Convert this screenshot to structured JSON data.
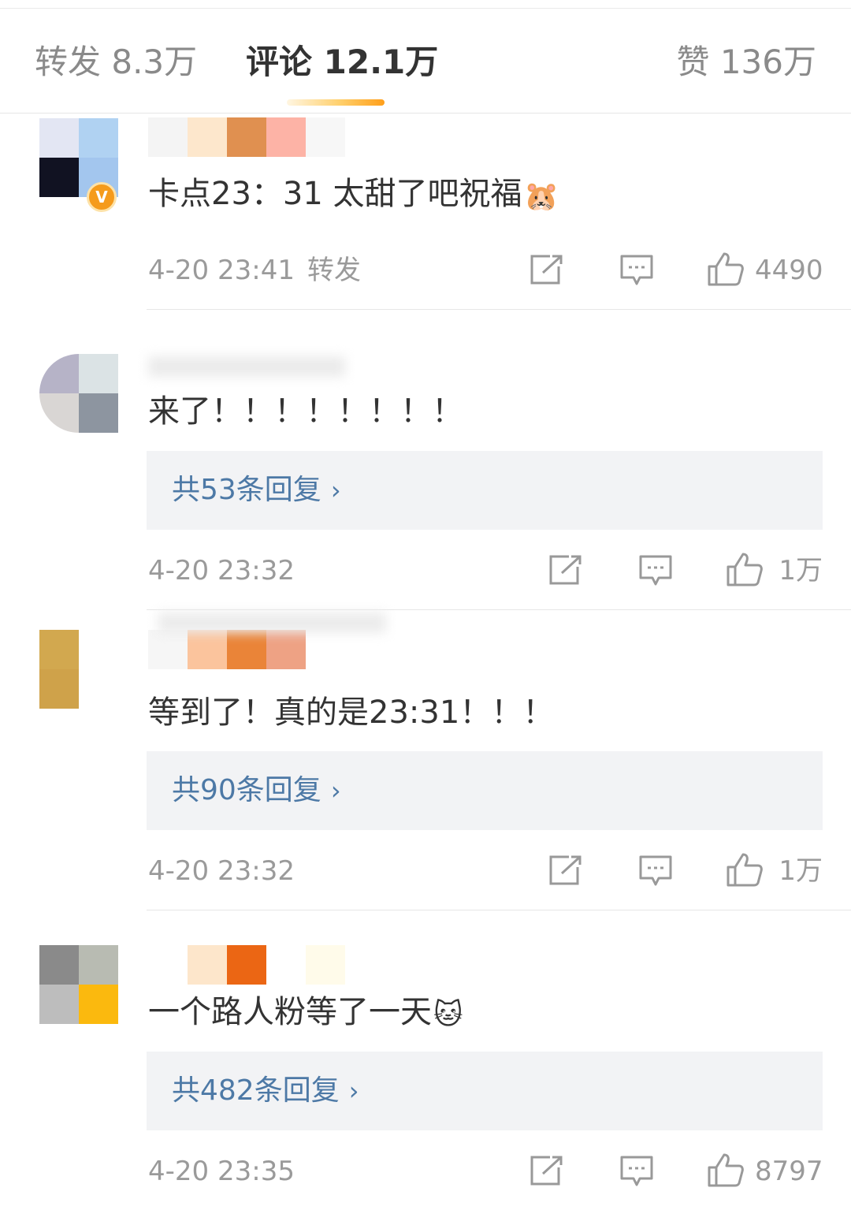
{
  "tabs": {
    "repost": "转发 8.3万",
    "comments": "评论 12.1万",
    "likes": "赞 136万"
  },
  "comments": [
    {
      "text": "卡点23：31  太甜了吧祝福",
      "emoji": "🐹",
      "verified_badge": "V",
      "time": "4-20 23:41",
      "repost_tag": "转发",
      "likes": "4490",
      "replies": ""
    },
    {
      "text": "来了！！！！！！！！",
      "time": "4-20 23:32",
      "replies": "共53条回复",
      "likes": "1万"
    },
    {
      "text": "等到了！真的是23:31！！！",
      "time": "4-20 23:32",
      "replies": "共90条回复",
      "likes": "1万"
    },
    {
      "text": "一个路人粉等了一天",
      "emoji": "🐱",
      "time": "4-20 23:35",
      "replies": "共482条回复",
      "likes": "8797"
    }
  ],
  "icons": {
    "share": "share-icon",
    "comment": "comment-icon",
    "like": "thumbs-up-icon",
    "chevron": "chevron-right-icon"
  },
  "colors": {
    "accent_gradient_end": "#ff9f1a",
    "reply_link": "#4d79a6",
    "reply_bg": "#f2f3f5"
  }
}
